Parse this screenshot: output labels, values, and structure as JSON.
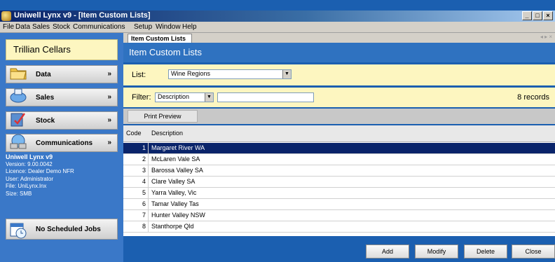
{
  "window": {
    "title": "Uniwell Lynx v9 - [Item Custom Lists]"
  },
  "menu": [
    "File",
    "Data",
    "Sales",
    "Stock",
    "Communications",
    "Setup",
    "Window",
    "Help"
  ],
  "sidebar": {
    "company": "Trillian Cellars",
    "items": [
      {
        "label": "Data",
        "icon": "folder-icon"
      },
      {
        "label": "Sales",
        "icon": "sales-icon"
      },
      {
        "label": "Stock",
        "icon": "stock-icon"
      },
      {
        "label": "Communications",
        "icon": "network-icon"
      }
    ],
    "info": {
      "app": "Uniwell Lynx v9",
      "version": "Version: 9.00.0042",
      "licence": "Licence: Dealer Demo NFR",
      "user": "User: Administrator",
      "file": "File: UniLynx.lnx",
      "size": "Size: SMB"
    },
    "jobs_label": "No Scheduled Jobs"
  },
  "main": {
    "tab_label": "Item Custom Lists",
    "header": "Item Custom Lists",
    "list_label": "List:",
    "list_value": "Wine Regions",
    "filter_label": "Filter:",
    "filter_field": "Description",
    "filter_text": "",
    "records": "8 records",
    "print_preview": "Print Preview",
    "columns": {
      "code": "Code",
      "description": "Description"
    },
    "rows": [
      {
        "code": "1",
        "description": "Margaret River WA"
      },
      {
        "code": "2",
        "description": "McLaren Vale SA"
      },
      {
        "code": "3",
        "description": "Barossa Valley SA"
      },
      {
        "code": "4",
        "description": "Clare Valley SA"
      },
      {
        "code": "5",
        "description": "Yarra Valley, Vic"
      },
      {
        "code": "6",
        "description": "Tamar Valley Tas"
      },
      {
        "code": "7",
        "description": "Hunter Valley NSW"
      },
      {
        "code": "8",
        "description": "Stanthorpe Qld"
      }
    ],
    "selected_row": 1,
    "buttons": {
      "add": "Add",
      "modify": "Modify",
      "delete": "Delete",
      "close": "Close"
    }
  }
}
